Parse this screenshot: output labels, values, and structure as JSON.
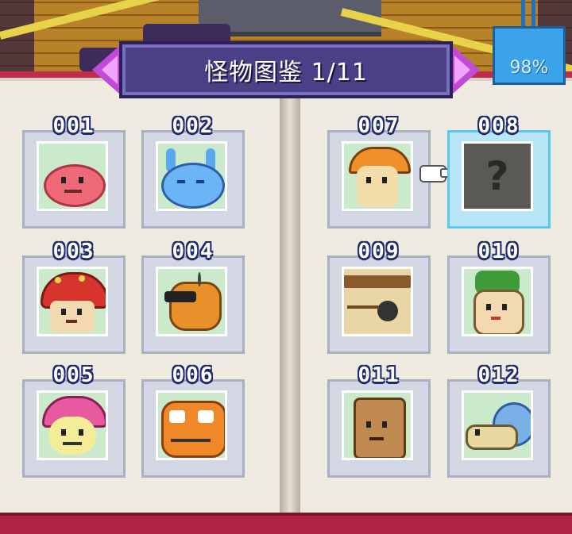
{
  "banner": {
    "title": "怪物图鉴 1/11"
  },
  "completion": {
    "percent": "98%"
  },
  "colors": {
    "book_cover": "#c22c4c",
    "page": "#efeae0",
    "banner": "#4b3f86",
    "arrow": "#c04bd6",
    "tag": "#3aa3ea",
    "selected_frame": "#b9e6f7"
  },
  "monsters": [
    {
      "number": "001",
      "icon": "pink-slime-icon"
    },
    {
      "number": "002",
      "icon": "blue-slime-icon"
    },
    {
      "number": "003",
      "icon": "red-mushroom-icon"
    },
    {
      "number": "004",
      "icon": "orange-beetle-icon"
    },
    {
      "number": "005",
      "icon": "pink-mushroom-icon"
    },
    {
      "number": "006",
      "icon": "orange-slime-icon"
    },
    {
      "number": "007",
      "icon": "orange-cap-mushroom-icon"
    },
    {
      "number": "008",
      "icon": "unknown-monster-icon",
      "locked_label": "?"
    },
    {
      "number": "009",
      "icon": "log-creature-icon"
    },
    {
      "number": "010",
      "icon": "leaf-sprout-icon"
    },
    {
      "number": "011",
      "icon": "tree-stump-icon"
    },
    {
      "number": "012",
      "icon": "snail-icon"
    }
  ]
}
